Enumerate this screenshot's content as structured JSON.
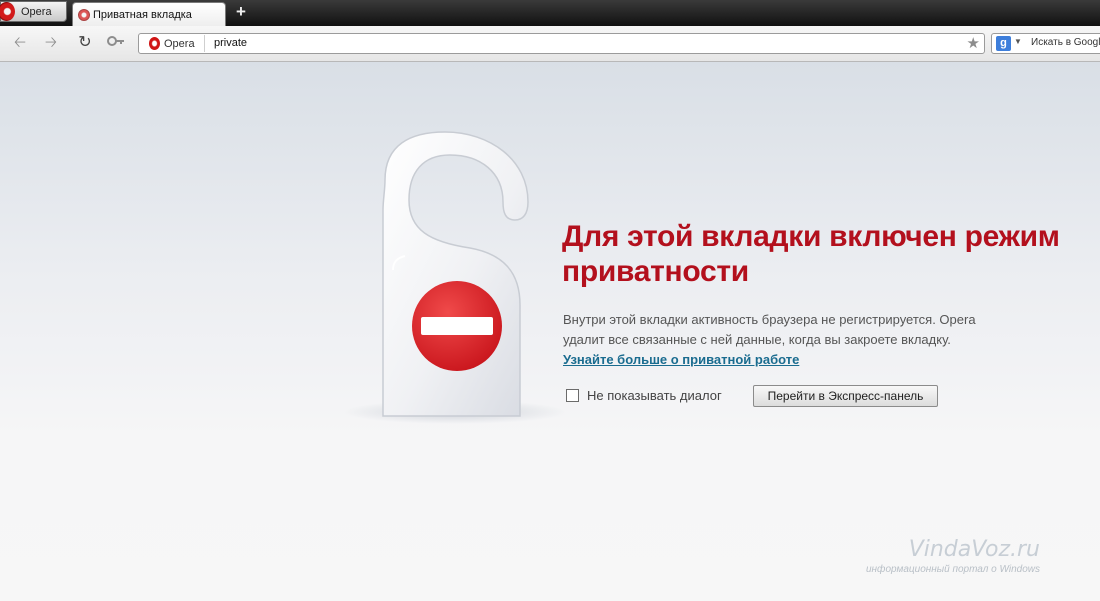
{
  "browser": {
    "menu_label": "Opera",
    "tab_title": "Приватная вкладка",
    "tab_close": "✕",
    "new_tab": "+"
  },
  "toolbar": {
    "back_icon": "back-arrow-icon",
    "forward_icon": "forward-arrow-icon",
    "reload_icon": "reload-icon",
    "key_icon": "key-icon",
    "address": {
      "badge": "Opera",
      "url": "private"
    },
    "bookmark_icon": "star-icon",
    "search": {
      "engine_icon": "google-icon",
      "placeholder": "Искать в Google"
    }
  },
  "page": {
    "headline": "Для этой вкладки включен режим приватности",
    "description": "Внутри этой вкладки активность браузера не регистрируется. Opera удалит все связанные с ней данные, когда вы закроете вкладку.",
    "learn_more_link": "Узнайте больше о приватной работе",
    "checkbox_label": "Не показывать диалог",
    "checkbox_checked": false,
    "express_button": "Перейти в Экспресс-панель",
    "icon": "do-not-disturb-hanger-icon"
  },
  "watermark": {
    "title": "VindaVoz.ru",
    "subtitle": "информационный портал о Windows"
  },
  "colors": {
    "headline": "#b3101d",
    "link": "#1a6c8f",
    "no_entry_sign": "#d21f26"
  }
}
